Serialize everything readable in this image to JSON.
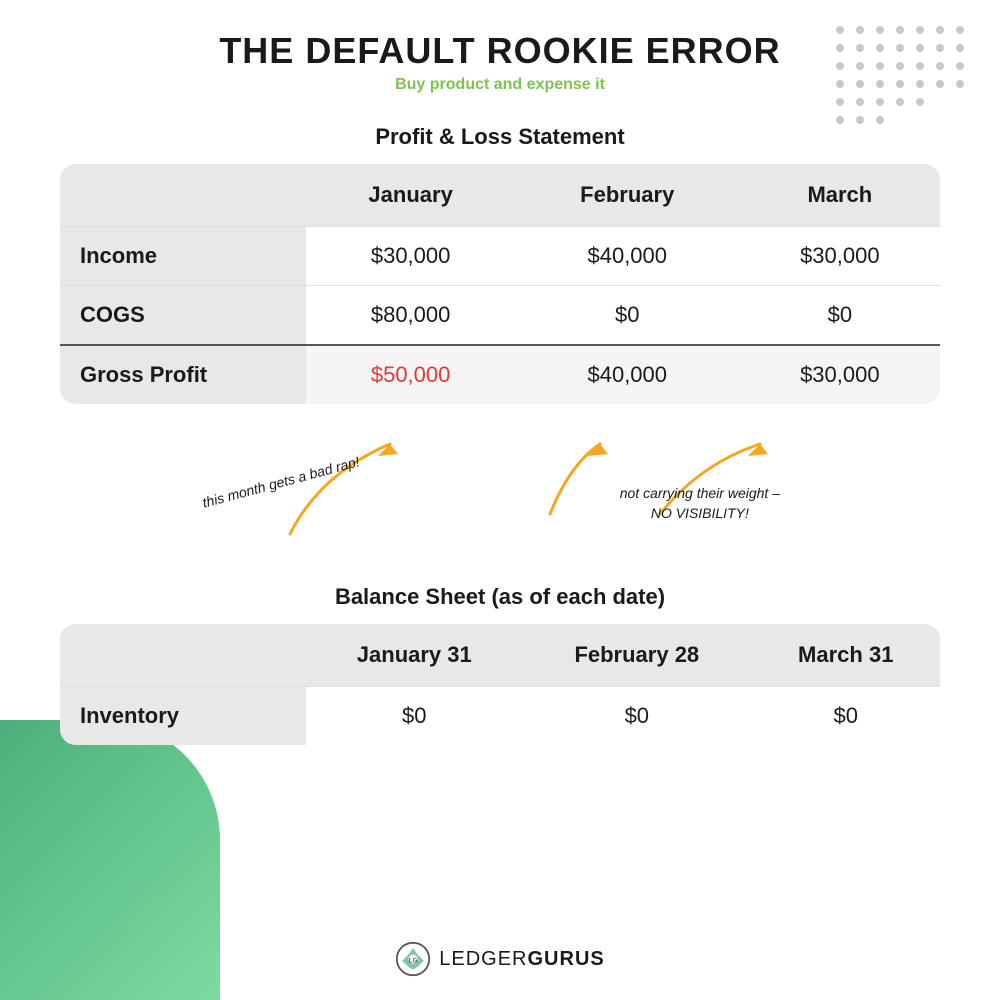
{
  "page": {
    "main_title": "THE DEFAULT ROOKIE ERROR",
    "subtitle": "Buy product and expense it"
  },
  "pnl": {
    "section_title": "Profit & Loss Statement",
    "columns": [
      "",
      "January",
      "February",
      "March"
    ],
    "rows": [
      {
        "label": "Income",
        "jan": "$30,000",
        "feb": "$40,000",
        "mar": "$30,000",
        "jan_red": false,
        "feb_red": false,
        "mar_red": false
      },
      {
        "label": "COGS",
        "jan": "$80,000",
        "feb": "$0",
        "mar": "$0",
        "jan_red": true,
        "feb_red": true,
        "mar_red": true
      },
      {
        "label": "Gross Profit",
        "jan": "$50,000",
        "feb": "$40,000",
        "mar": "$30,000",
        "jan_red": true,
        "feb_red": false,
        "mar_red": false
      }
    ]
  },
  "annotations": {
    "left_text": "this month gets a bad rap!",
    "right_text": "not carrying their weight –\nNO VISIBILITY!"
  },
  "balance": {
    "section_title": "Balance Sheet (as of each date)",
    "columns": [
      "",
      "January 31",
      "February 28",
      "March 31"
    ],
    "rows": [
      {
        "label": "Inventory",
        "jan": "$0",
        "feb": "$0",
        "mar": "$0"
      }
    ]
  },
  "footer": {
    "logo_text_light": "LEDGER",
    "logo_text_bold": "GURUS"
  }
}
